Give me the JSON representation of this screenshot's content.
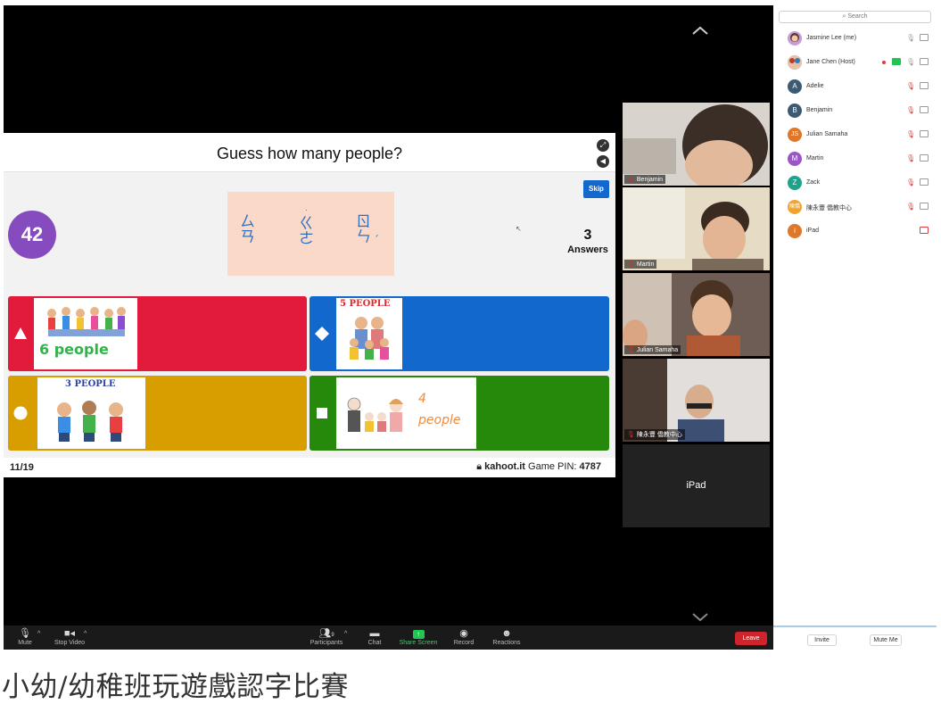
{
  "kahoot": {
    "question": "Guess how many people?",
    "timer": "42",
    "zhuyin": [
      {
        "top": "ㄙ",
        "bottom": "ㄢ"
      },
      {
        "top": "ㄍ",
        "bottom": "ㄜ"
      },
      {
        "top": "ㄖ",
        "bottom": "ㄣ"
      }
    ],
    "skip_label": "Skip",
    "answers_count": "3",
    "answers_label": "Answers",
    "options": [
      {
        "shape": "triangle",
        "label": "6 people",
        "color": "#e21b3c"
      },
      {
        "shape": "diamond",
        "label": "5 PEOPLE",
        "color": "#1368ce"
      },
      {
        "shape": "circle",
        "label": "3 PEOPLE",
        "color": "#d89e00"
      },
      {
        "shape": "square",
        "label_line1": "4",
        "label_line2": "people",
        "color": "#26890c"
      }
    ],
    "question_count": "11/19",
    "site": "kahoot.it",
    "pin_label": "Game PIN:",
    "pin": "4787"
  },
  "gallery": [
    {
      "name": "Benjamin"
    },
    {
      "name": "Martin"
    },
    {
      "name": "Julian Samaha"
    },
    {
      "name": "陳永豐 僑教中心"
    },
    {
      "name": "iPad"
    }
  ],
  "toolbar": {
    "mute": "Mute",
    "stop_video": "Stop Video",
    "participants": "Participants",
    "participants_count": "9",
    "chat": "Chat",
    "share_screen": "Share Screen",
    "record": "Record",
    "reactions": "Reactions",
    "leave": "Leave"
  },
  "panel": {
    "search_placeholder": "Search",
    "participants": [
      {
        "avatar": "",
        "color": "#c79bd6",
        "name": "Jasmine Lee (me)",
        "mic": "on",
        "cam": "on"
      },
      {
        "avatar": "",
        "color": "#d98a8a",
        "name": "Jane Chen (Host)",
        "mic": "on",
        "cam": "on"
      },
      {
        "avatar": "A",
        "color": "#3d5a73",
        "name": "Adelie",
        "mic": "muted",
        "cam": "on"
      },
      {
        "avatar": "B",
        "color": "#3d5a73",
        "name": "Benjamin",
        "mic": "muted",
        "cam": "on"
      },
      {
        "avatar": "JS",
        "color": "#e0762a",
        "name": "Julian Samaha",
        "mic": "muted",
        "cam": "on"
      },
      {
        "avatar": "M",
        "color": "#9a55c8",
        "name": "Martin",
        "mic": "muted",
        "cam": "on"
      },
      {
        "avatar": "Z",
        "color": "#1fa28a",
        "name": "Zack",
        "mic": "muted",
        "cam": "on"
      },
      {
        "avatar": "陳僑",
        "color": "#f0a430",
        "name": "陳永豐 僑教中心",
        "mic": "muted",
        "cam": "on"
      },
      {
        "avatar": "i",
        "color": "#e0762a",
        "name": "iPad",
        "mic": "",
        "cam": "off"
      }
    ],
    "invite": "Invite",
    "mute_me": "Mute Me"
  },
  "caption": "小幼/幼稚班玩遊戲認字比賽"
}
